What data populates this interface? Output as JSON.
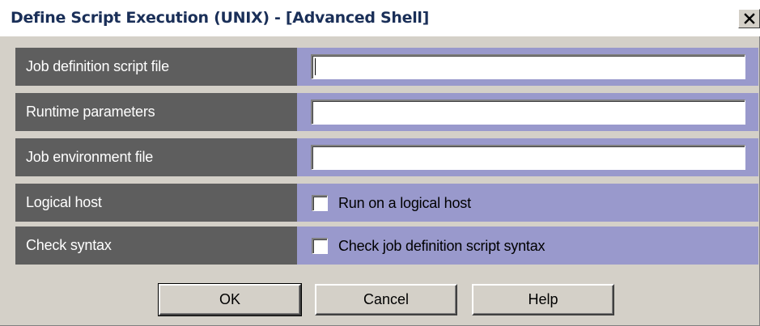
{
  "window": {
    "title": "Define Script Execution (UNIX) - [Advanced Shell]",
    "close_icon": "close-icon"
  },
  "form": {
    "rows": [
      {
        "label": "Job definition script file",
        "type": "text",
        "value": ""
      },
      {
        "label": "Runtime parameters",
        "type": "text",
        "value": ""
      },
      {
        "label": "Job environment file",
        "type": "text",
        "value": ""
      },
      {
        "label": "Logical host",
        "type": "checkbox",
        "checkbox_label": "Run on a logical host",
        "checked": false
      },
      {
        "label": "Check syntax",
        "type": "checkbox",
        "checkbox_label": "Check job definition script syntax",
        "checked": false
      }
    ]
  },
  "buttons": {
    "ok": "OK",
    "cancel": "Cancel",
    "help": "Help"
  },
  "colors": {
    "label_bg": "#5e5e5e",
    "value_bg": "#9999cc",
    "dialog_bg": "#d4d0c8",
    "title_text": "#1a2f58"
  }
}
